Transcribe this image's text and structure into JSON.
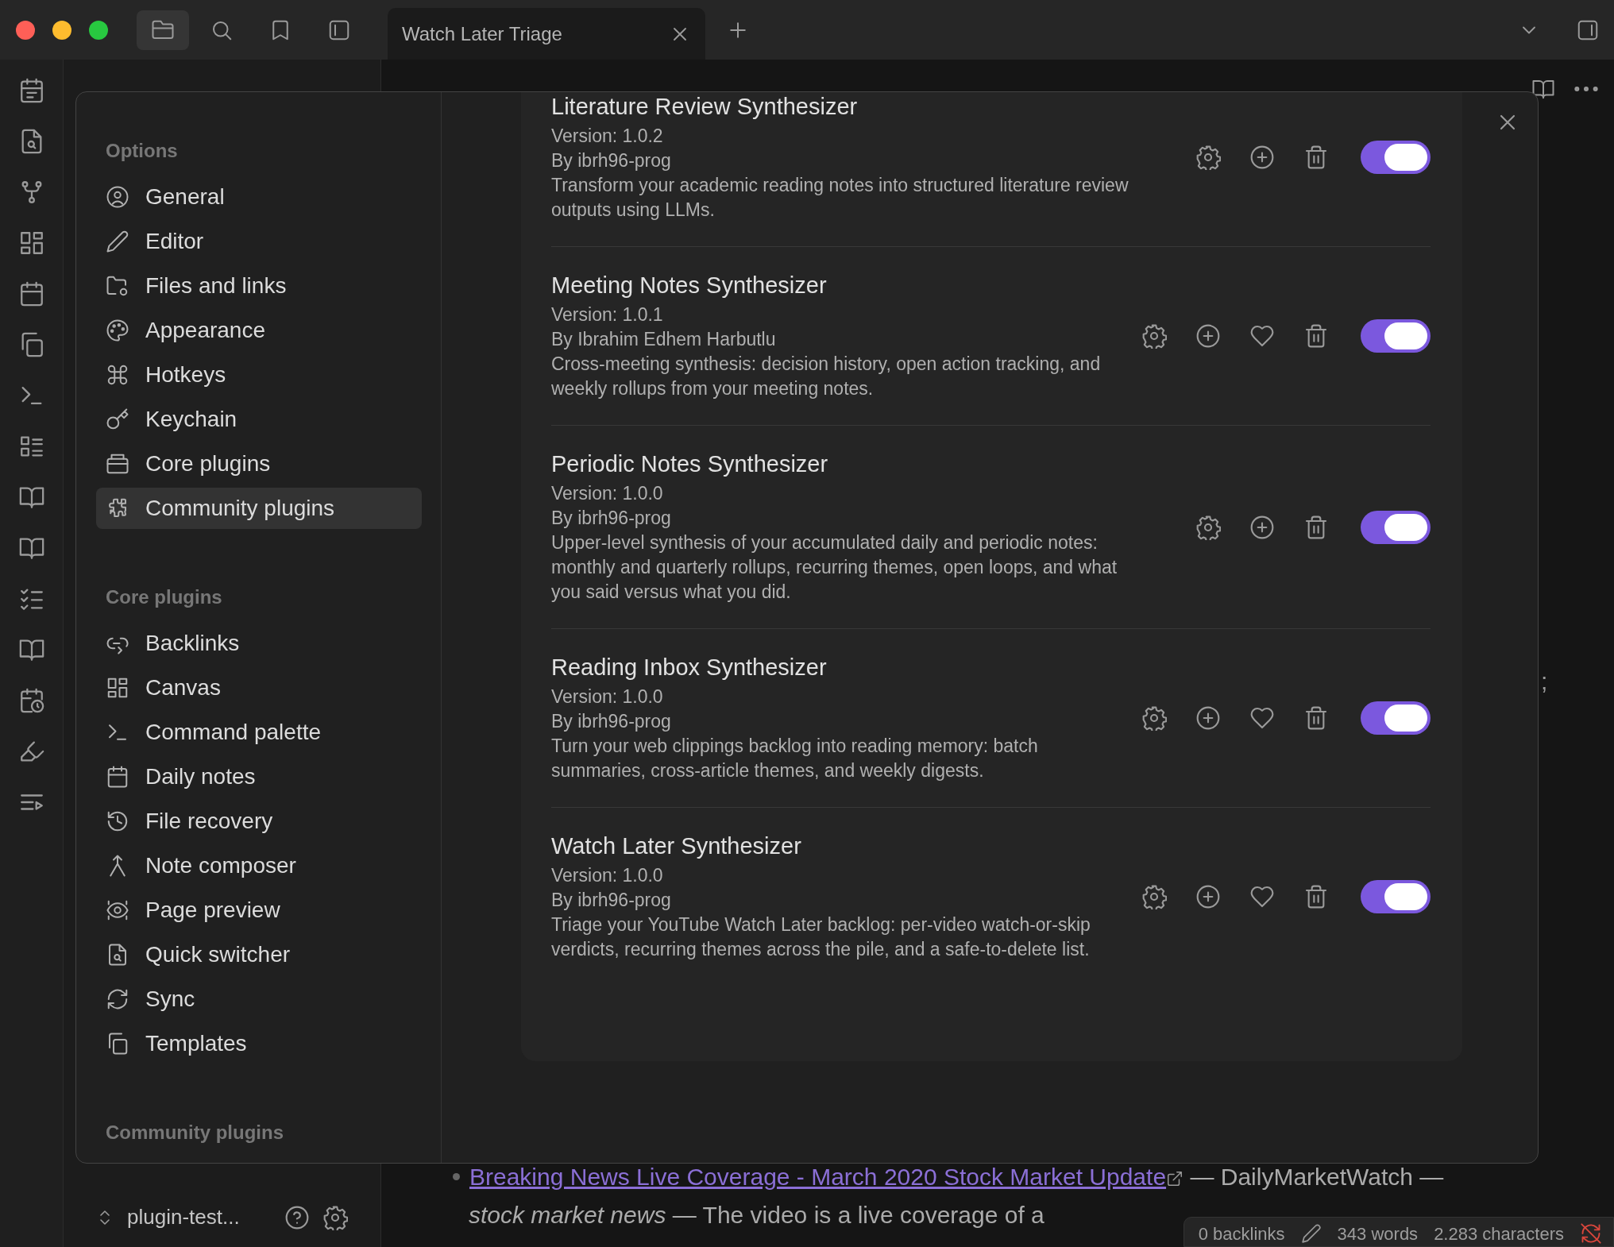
{
  "titlebar": {
    "tabs": [
      {
        "title": "Watch Later Triage",
        "selected": true
      }
    ]
  },
  "explorer": {
    "vault": "plugin-test..."
  },
  "view": {
    "fragment": ";"
  },
  "note": {
    "link": "Breaking News Live Coverage - March 2020 Stock Market Update",
    "rest": "— DailyMarketWatch —",
    "line2": "*stock market news* — The video is a live coverage of a"
  },
  "status_bar": {
    "backlinks": "0 backlinks",
    "words": "343 words",
    "characters": "2.283 characters"
  },
  "settings": {
    "sections": [
      {
        "heading": "Options",
        "items": [
          {
            "label": "General",
            "selected": false
          },
          {
            "label": "Editor",
            "selected": false
          },
          {
            "label": "Files and links",
            "selected": false
          },
          {
            "label": "Appearance",
            "selected": false
          },
          {
            "label": "Hotkeys",
            "selected": false
          },
          {
            "label": "Keychain",
            "selected": false
          },
          {
            "label": "Core plugins",
            "selected": false
          },
          {
            "label": "Community plugins",
            "selected": true
          }
        ]
      },
      {
        "heading": "Core plugins",
        "items": [
          {
            "label": "Backlinks",
            "selected": false
          },
          {
            "label": "Canvas",
            "selected": false
          },
          {
            "label": "Command palette",
            "selected": false
          },
          {
            "label": "Daily notes",
            "selected": false
          },
          {
            "label": "File recovery",
            "selected": false
          },
          {
            "label": "Note composer",
            "selected": false
          },
          {
            "label": "Page preview",
            "selected": false
          },
          {
            "label": "Quick switcher",
            "selected": false
          },
          {
            "label": "Sync",
            "selected": false
          },
          {
            "label": "Templates",
            "selected": false
          }
        ]
      },
      {
        "heading": "Community plugins"
      }
    ],
    "plugins": [
      {
        "name": "Literature Review Synthesizer",
        "version": "Version: 1.0.2",
        "author": "By ibrh96-prog",
        "description": "Transform your academic reading notes into structured literature review outputs using LLMs.",
        "sponsor": false,
        "enabled": true
      },
      {
        "name": "Meeting Notes Synthesizer",
        "version": "Version: 1.0.1",
        "author": "By Ibrahim Edhem Harbutlu",
        "description": "Cross-meeting synthesis: decision history, open action tracking, and weekly rollups from your meeting notes.",
        "sponsor": true,
        "enabled": true
      },
      {
        "name": "Periodic Notes Synthesizer",
        "version": "Version: 1.0.0",
        "author": "By ibrh96-prog",
        "description": "Upper-level synthesis of your accumulated daily and periodic notes: monthly and quarterly rollups, recurring themes, open loops, and what you said versus what you did.",
        "sponsor": false,
        "enabled": true
      },
      {
        "name": "Reading Inbox Synthesizer",
        "version": "Version: 1.0.0",
        "author": "By ibrh96-prog",
        "description": "Turn your web clippings backlog into reading memory: batch summaries, cross-article themes, and weekly digests.",
        "sponsor": true,
        "enabled": true
      },
      {
        "name": "Watch Later Synthesizer",
        "version": "Version: 1.0.0",
        "author": "By ibrh96-prog",
        "description": "Triage your YouTube Watch Later backlog: per-video watch-or-skip verdicts, recurring themes across the pile, and a safe-to-delete list.",
        "sponsor": true,
        "enabled": true
      }
    ]
  }
}
